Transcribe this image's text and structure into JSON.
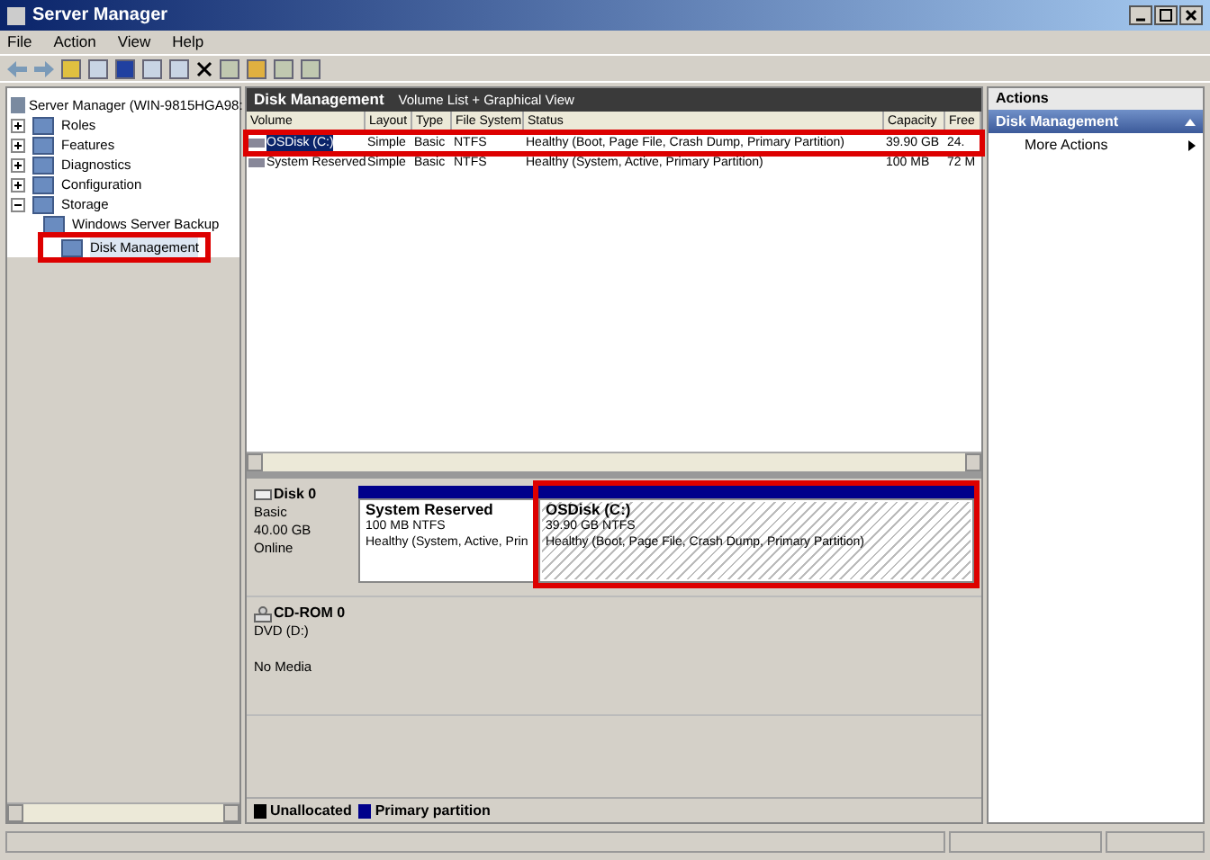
{
  "window": {
    "title": "Server Manager"
  },
  "menu": [
    "File",
    "Action",
    "View",
    "Help"
  ],
  "tree": {
    "label": "Server Manager (WIN-9815HGA98:",
    "children": [
      {
        "label": "Roles",
        "expanded": false,
        "highlighted": false
      },
      {
        "label": "Features",
        "expanded": false,
        "highlighted": false
      },
      {
        "label": "Diagnostics",
        "expanded": false,
        "highlighted": false
      },
      {
        "label": "Configuration",
        "expanded": false,
        "highlighted": false
      },
      {
        "label": "Storage",
        "expanded": true,
        "highlighted": false,
        "children": [
          {
            "label": "Windows Server Backup",
            "highlighted": false
          },
          {
            "label": "Disk Management",
            "highlighted": true
          }
        ]
      }
    ]
  },
  "center": {
    "title": "Disk Management",
    "subtitle": "Volume List + Graphical View",
    "columns": [
      "Volume",
      "Layout",
      "Type",
      "File System",
      "Status",
      "Capacity",
      "Free"
    ],
    "rows": [
      {
        "cells": [
          "OSDisk (C:)",
          "Simple",
          "Basic",
          "NTFS",
          "Healthy (Boot, Page File, Crash Dump, Primary Partition)",
          "39.90 GB",
          "24."
        ],
        "selected": true,
        "highlighted": true
      },
      {
        "cells": [
          "System Reserved",
          "Simple",
          "Basic",
          "NTFS",
          "Healthy (System, Active, Primary Partition)",
          "100 MB",
          "72 M"
        ],
        "selected": false,
        "highlighted": false
      }
    ]
  },
  "disks": [
    {
      "kind": "disk",
      "name": "Disk 0",
      "info": [
        "Basic",
        "40.00 GB",
        "Online"
      ],
      "partitions": [
        {
          "name": "System Reserved",
          "size": "100 MB NTFS",
          "status": "Healthy (System, Active, Prin",
          "hatched": false,
          "highlighted": false
        },
        {
          "name": "OSDisk  (C:)",
          "size": "39.90 GB NTFS",
          "status": "Healthy (Boot, Page File, Crash Dump, Primary Partition)",
          "hatched": true,
          "highlighted": true
        }
      ]
    },
    {
      "kind": "cdrom",
      "name": "CD-ROM 0",
      "info": [
        "DVD (D:)",
        "No Media"
      ]
    }
  ],
  "legend": [
    {
      "label": "Unallocated",
      "color": "#000000"
    },
    {
      "label": "Primary partition",
      "color": "#00008b"
    }
  ],
  "actions": {
    "title": "Actions",
    "section": "Disk Management",
    "items": [
      "More Actions"
    ]
  }
}
